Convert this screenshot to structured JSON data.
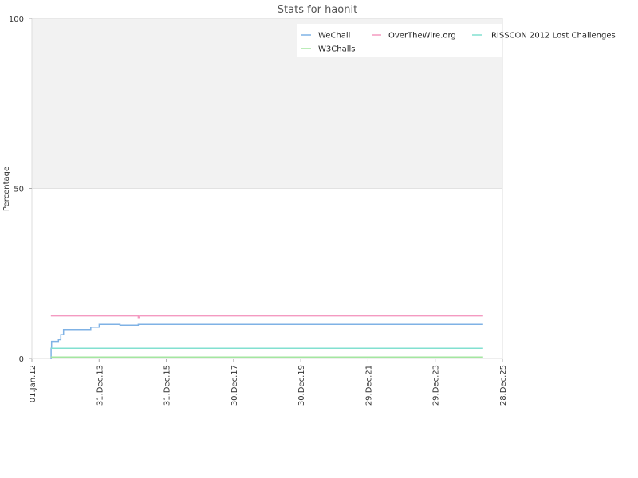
{
  "chart_data": {
    "type": "line",
    "title": "Stats for haonit",
    "xlabel": "",
    "ylabel": "Percentage",
    "ylim": [
      0,
      100
    ],
    "y_ticks": [
      "0",
      "50",
      "100"
    ],
    "x_ticks": [
      "01.Jan.12",
      "31.Dec.13",
      "31.Dec.15",
      "30.Dec.17",
      "30.Dec.19",
      "29.Dec.21",
      "29.Dec.23",
      "28.Dec.25"
    ],
    "x_range": [
      "2012-01-01",
      "2025-12-28"
    ],
    "shaded_band": [
      50,
      100
    ],
    "legend_position": "top-right",
    "series": [
      {
        "name": "WeChall",
        "color": "#7fb2e5",
        "points": [
          [
            "2012-07-25",
            0
          ],
          [
            "2012-07-28",
            3
          ],
          [
            "2012-08-02",
            5
          ],
          [
            "2012-10-15",
            5.5
          ],
          [
            "2012-11-10",
            7
          ],
          [
            "2012-12-10",
            8.5
          ],
          [
            "2013-05-01",
            8.5
          ],
          [
            "2013-09-15",
            8.5
          ],
          [
            "2013-10-01",
            9.2
          ],
          [
            "2014-01-01",
            10
          ],
          [
            "2014-08-01",
            10
          ],
          [
            "2014-08-15",
            9.8
          ],
          [
            "2015-02-01",
            9.8
          ],
          [
            "2015-03-01",
            10
          ],
          [
            "2025-06-01",
            10
          ]
        ]
      },
      {
        "name": "OverTheWire.org",
        "color": "#f49ac1",
        "points": [
          [
            "2012-07-25",
            12.5
          ],
          [
            "2015-02-15",
            12.5
          ],
          [
            "2015-03-01",
            12
          ],
          [
            "2015-03-15",
            12.5
          ],
          [
            "2025-06-01",
            12.5
          ]
        ]
      },
      {
        "name": "IRISSCON 2012 Lost Challenges",
        "color": "#82e0d0",
        "points": [
          [
            "2012-07-25",
            3
          ],
          [
            "2025-06-01",
            3
          ]
        ]
      },
      {
        "name": "W3Challs",
        "color": "#a4e6a0",
        "points": [
          [
            "2012-07-25",
            0.4
          ],
          [
            "2025-06-01",
            0.4
          ]
        ]
      }
    ]
  }
}
